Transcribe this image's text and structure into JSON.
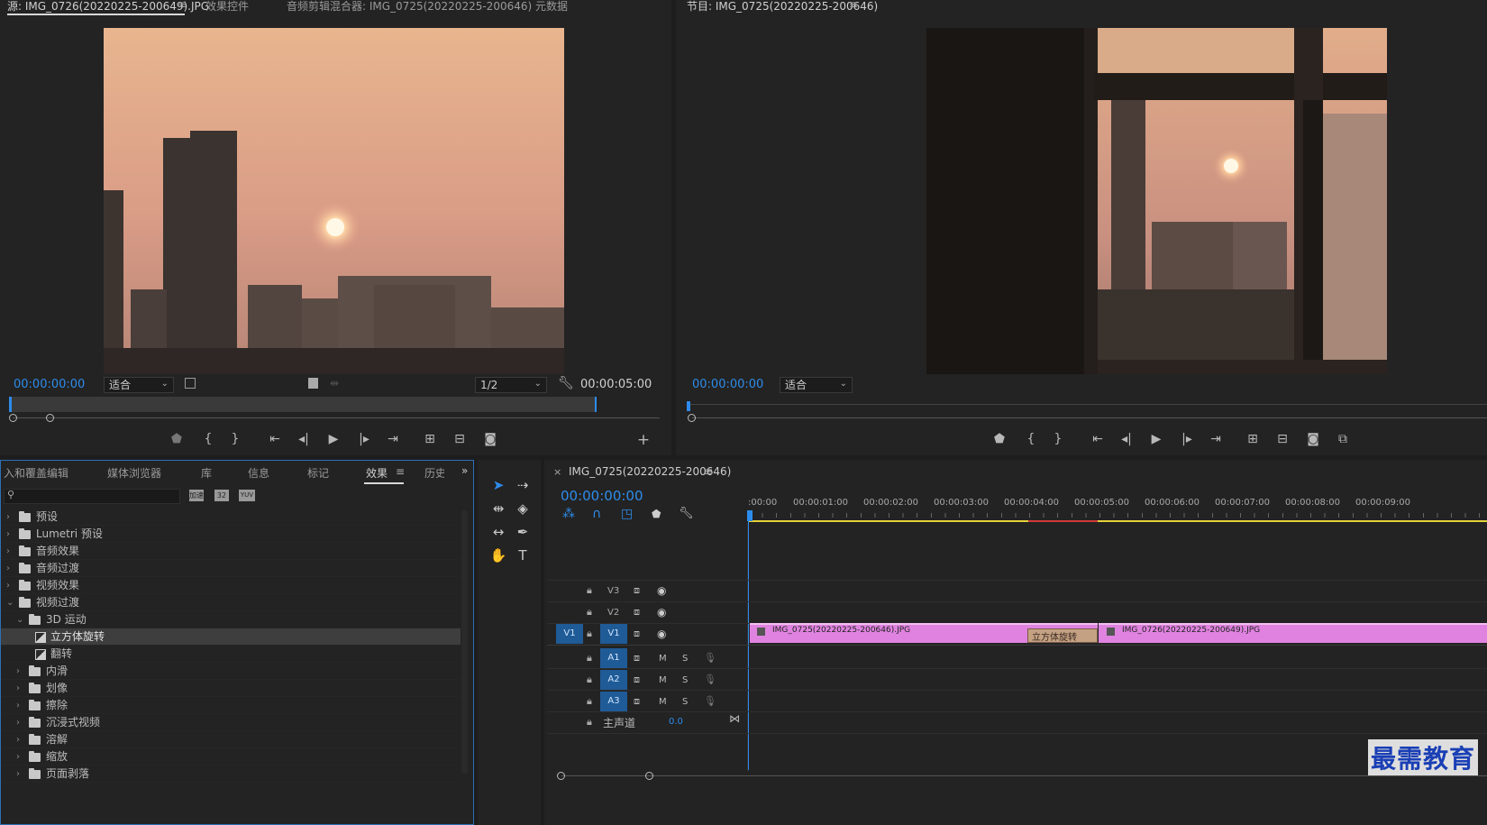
{
  "source_monitor": {
    "tabs": [
      "源: IMG_0726(20220225-200649).JPG",
      "效果控件",
      "音频剪辑混合器: IMG_0725(20220225-200646)",
      "元数据"
    ],
    "timecode": "00:00:00:00",
    "fit": "适合",
    "resolution": "1/2",
    "duration": "00:00:05:00"
  },
  "program_monitor": {
    "title": "节目: IMG_0725(20220225-200646)",
    "timecode": "00:00:00:00",
    "fit": "适合"
  },
  "effects_panel": {
    "tabs": [
      "入和覆盖编辑",
      "媒体浏览器",
      "库",
      "信息",
      "标记",
      "效果",
      "历史"
    ],
    "active_tab": "效果",
    "filter_buttons": [
      "加速",
      "32",
      "YUV"
    ],
    "tree": [
      {
        "label": "预设",
        "level": 0,
        "type": "special-folder"
      },
      {
        "label": "Lumetri 预设",
        "level": 0,
        "type": "special-folder"
      },
      {
        "label": "音频效果",
        "level": 0,
        "type": "folder"
      },
      {
        "label": "音频过渡",
        "level": 0,
        "type": "folder"
      },
      {
        "label": "视频效果",
        "level": 0,
        "type": "folder"
      },
      {
        "label": "视频过渡",
        "level": 0,
        "type": "folder",
        "open": true
      },
      {
        "label": "3D 运动",
        "level": 1,
        "type": "folder",
        "open": true
      },
      {
        "label": "立方体旋转",
        "level": 2,
        "type": "effect",
        "selected": true
      },
      {
        "label": "翻转",
        "level": 2,
        "type": "effect"
      },
      {
        "label": "内滑",
        "level": 1,
        "type": "folder"
      },
      {
        "label": "划像",
        "level": 1,
        "type": "folder"
      },
      {
        "label": "擦除",
        "level": 1,
        "type": "folder"
      },
      {
        "label": "沉浸式视频",
        "level": 1,
        "type": "folder"
      },
      {
        "label": "溶解",
        "level": 1,
        "type": "folder"
      },
      {
        "label": "缩放",
        "level": 1,
        "type": "folder"
      },
      {
        "label": "页面剥落",
        "level": 1,
        "type": "folder"
      }
    ]
  },
  "timeline": {
    "sequence_tab": "IMG_0725(20220225-200646)",
    "timecode": "00:00:00:00",
    "ruler": [
      ":00:00",
      "00:00:01:00",
      "00:00:02:00",
      "00:00:03:00",
      "00:00:04:00",
      "00:00:05:00",
      "00:00:06:00",
      "00:00:07:00",
      "00:00:08:00",
      "00:00:09:00"
    ],
    "video_tracks": [
      "V3",
      "V2",
      "V1"
    ],
    "audio_tracks": [
      "A1",
      "A2",
      "A3"
    ],
    "source_patch_label": "V1",
    "mute_label": "M",
    "solo_label": "S",
    "master_label": "主声道",
    "master_value": "0.0",
    "clips": [
      {
        "name": "IMG_0725(20220225-200646).JPG",
        "color": "#e083e0"
      },
      {
        "name": "IMG_0726(20220225-200649).JPG",
        "color": "#e083e0"
      }
    ],
    "transition": "立方体旋转"
  },
  "watermark": "最需教育",
  "colors": {
    "accent": "#2d8ceb",
    "clip": "#e083e0",
    "transition": "#c4a182",
    "bg": "#1d1d1d"
  }
}
